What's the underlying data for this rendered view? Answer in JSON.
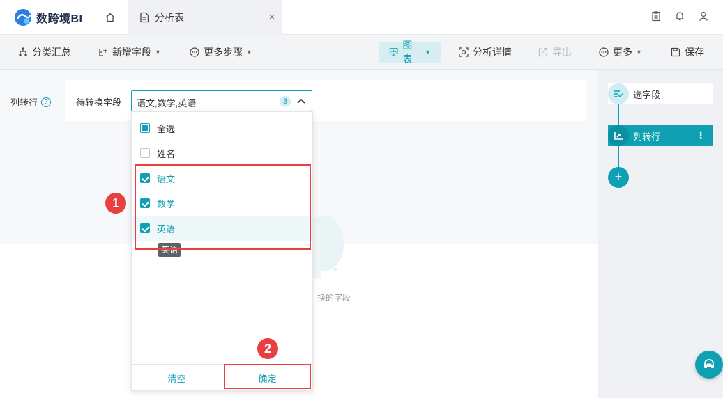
{
  "app": {
    "logo_text": "数跨境BI"
  },
  "tabs": {
    "doc_label": "分析表",
    "close_glyph": "×"
  },
  "toolbar": {
    "group_summary": "分类汇总",
    "add_field": "新增字段",
    "more_steps": "更多步骤",
    "chart": "图表",
    "analysis_detail": "分析详情",
    "export": "导出",
    "more": "更多",
    "save": "保存"
  },
  "config": {
    "label": "列转行",
    "help": "?",
    "field_label": "待转换字段",
    "selected_value": "语文,数学,英语",
    "selected_count": "3"
  },
  "dropdown": {
    "items": [
      {
        "label": "全选",
        "state": "partial"
      },
      {
        "label": "姓名",
        "state": "unchecked"
      },
      {
        "label": "语文",
        "state": "checked"
      },
      {
        "label": "数学",
        "state": "checked"
      },
      {
        "label": "英语",
        "state": "checked"
      }
    ],
    "tooltip": "英语",
    "clear_label": "清空",
    "confirm_label": "确定"
  },
  "empty_state": {
    "text": "换的字段"
  },
  "annotations": {
    "badge_1": "1",
    "badge_2": "2"
  },
  "steps": {
    "step1": "选字段",
    "step2": "列转行",
    "more_glyph": "⋮",
    "add_glyph": "+"
  },
  "colors": {
    "accent": "#10a0b3",
    "annotation": "#e84040"
  }
}
